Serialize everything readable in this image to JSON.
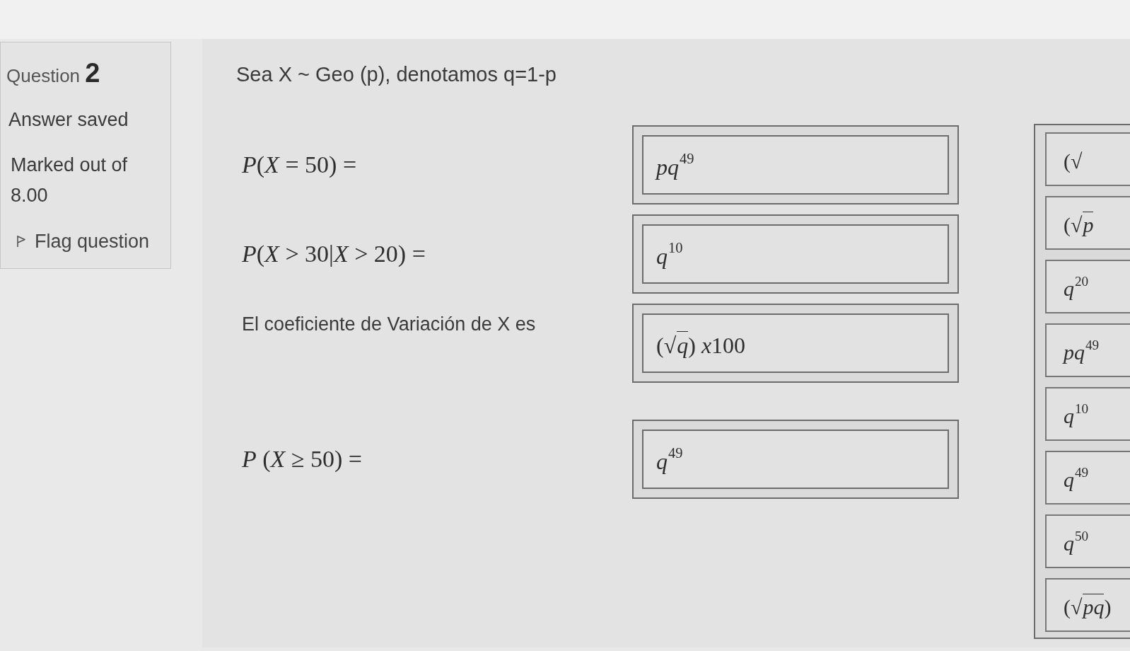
{
  "question_info": {
    "title": "Question **2**",
    "status": "Answer saved",
    "marks": "Marked out of 8.00",
    "flag_link": "Flag question"
  },
  "question": {
    "intro": "Sea X ~ Geo (p), denotamos q=1-p",
    "rows": [
      {
        "prompt": {
          "kind": "math",
          "tokens": [
            {
              "kind": "var",
              "text": "P"
            },
            {
              "kind": "text",
              "text": "("
            },
            {
              "kind": "var",
              "text": "X"
            },
            {
              "kind": "text",
              "text": " = 50) ="
            }
          ]
        },
        "answer": [
          {
            "kind": "var",
            "text": "pq"
          },
          {
            "kind": "sup",
            "text": "49"
          }
        ]
      },
      {
        "prompt": {
          "kind": "math",
          "tokens": [
            {
              "kind": "var",
              "text": "P"
            },
            {
              "kind": "text",
              "text": "("
            },
            {
              "kind": "var",
              "text": "X"
            },
            {
              "kind": "text",
              "text": " > 30|"
            },
            {
              "kind": "var",
              "text": "X"
            },
            {
              "kind": "text",
              "text": " > 20) ="
            }
          ]
        },
        "answer": [
          {
            "kind": "var",
            "text": "q"
          },
          {
            "kind": "sup",
            "text": "10"
          }
        ]
      },
      {
        "prompt": {
          "kind": "text",
          "text": "El coeficiente de Variación de X es"
        },
        "answer": [
          {
            "kind": "text",
            "text": "(√"
          },
          {
            "kind": "overline",
            "text": "q"
          },
          {
            "kind": "text",
            "text": ") "
          },
          {
            "kind": "var",
            "text": "x"
          },
          {
            "kind": "text",
            "text": "100"
          }
        ]
      },
      {
        "prompt": {
          "kind": "math",
          "tokens": [
            {
              "kind": "var",
              "text": "P"
            },
            {
              "kind": "text",
              "text": " ("
            },
            {
              "kind": "var",
              "text": "X"
            },
            {
              "kind": "text",
              "text": " ≥ 50) ="
            }
          ]
        },
        "answer": [
          {
            "kind": "var",
            "text": "q"
          },
          {
            "kind": "sup",
            "text": "49"
          }
        ]
      }
    ],
    "choices": [
      [
        {
          "kind": "text",
          "text": "(√"
        }
      ],
      [
        {
          "kind": "text",
          "text": "(√"
        },
        {
          "kind": "overline",
          "text": "p"
        }
      ],
      [
        {
          "kind": "var",
          "text": "q"
        },
        {
          "kind": "sup",
          "text": "20"
        }
      ],
      [
        {
          "kind": "var",
          "text": "pq"
        },
        {
          "kind": "sup",
          "text": "49"
        }
      ],
      [
        {
          "kind": "var",
          "text": "q"
        },
        {
          "kind": "sup",
          "text": "10"
        }
      ],
      [
        {
          "kind": "var",
          "text": "q"
        },
        {
          "kind": "sup",
          "text": "49"
        }
      ],
      [
        {
          "kind": "var",
          "text": "q"
        },
        {
          "kind": "sup",
          "text": "50"
        }
      ],
      [
        {
          "kind": "text",
          "text": "(√"
        },
        {
          "kind": "overline",
          "text": "pq"
        },
        {
          "kind": "text",
          "text": ")"
        }
      ]
    ]
  }
}
